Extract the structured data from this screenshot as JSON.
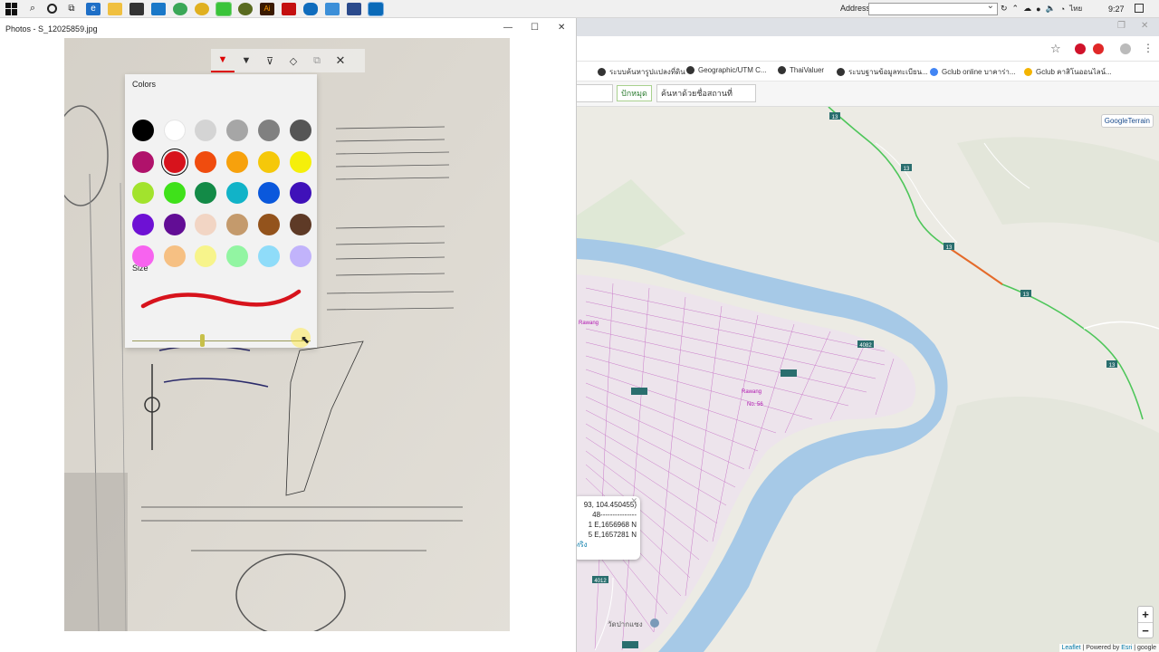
{
  "taskbar": {
    "address_label": "Address",
    "address_value": "",
    "time": "9:27",
    "language": "ไทย"
  },
  "photos": {
    "title": "Photos - S_12025859.jpg",
    "controls": {
      "minimize": "—",
      "maximize": "☐",
      "close": "✕"
    },
    "ink_tools": [
      "ballpoint-pen",
      "pencil",
      "calligraphy-pen",
      "eraser",
      "touch-writing"
    ],
    "selected_tool": "ballpoint-pen",
    "colors_label": "Colors",
    "size_label": "Size",
    "selected_color": "#d7131c",
    "size_fraction": 0.39,
    "colors": [
      "#000000",
      "#ffffff",
      "#d4d4d4",
      "#a6a6a6",
      "#808080",
      "#555555",
      "#b0126b",
      "#d7131c",
      "#f04c0e",
      "#f7a10c",
      "#f5c80a",
      "#f5ef0a",
      "#a2e32d",
      "#3fe11a",
      "#138a47",
      "#11b3c8",
      "#0a58dc",
      "#3f11b9",
      "#6e11d4",
      "#620d95",
      "#f2d5c4",
      "#c49a6c",
      "#93531c",
      "#5e3a26",
      "#f763ef",
      "#f6c083",
      "#f7f48b",
      "#92f5a2",
      "#8fdcf9",
      "#c1b3fb"
    ]
  },
  "browser": {
    "bookmarks": [
      "ระบบค้นหารูปแปลงที่ดิน",
      "Geographic/UTM C...",
      "ThaiValuer",
      "ระบบฐานข้อมูลทะเบียน...",
      "Gclub online บาคาร่า...",
      "Gclub คาสิโนออนไลน์..."
    ],
    "clear_button": "ปักหมุด",
    "place_search": "ค้นหาด้วยชื่อสถานที่",
    "map": {
      "layer_button": "GoogleTerrain",
      "zoom_in": "+",
      "zoom_out": "−",
      "attribution_leaflet": "Leaflet",
      "attribution_text": "| Powered by",
      "attribution_esri": "Esri",
      "attribution_tail": "| google",
      "popup": {
        "coords": "93, 104.450455)",
        "sep": "48---------------",
        "line1": "1 E,1656968 N",
        "line2": "5 E,1657281 N",
        "link": "ทริง"
      },
      "labels": {
        "route13": "13",
        "route4082": "4082",
        "route2112": "2112",
        "route4012": "4012",
        "parcel_a": "Rawang",
        "parcel_b": "Rawang",
        "village": "วัดปากแซง"
      }
    }
  }
}
